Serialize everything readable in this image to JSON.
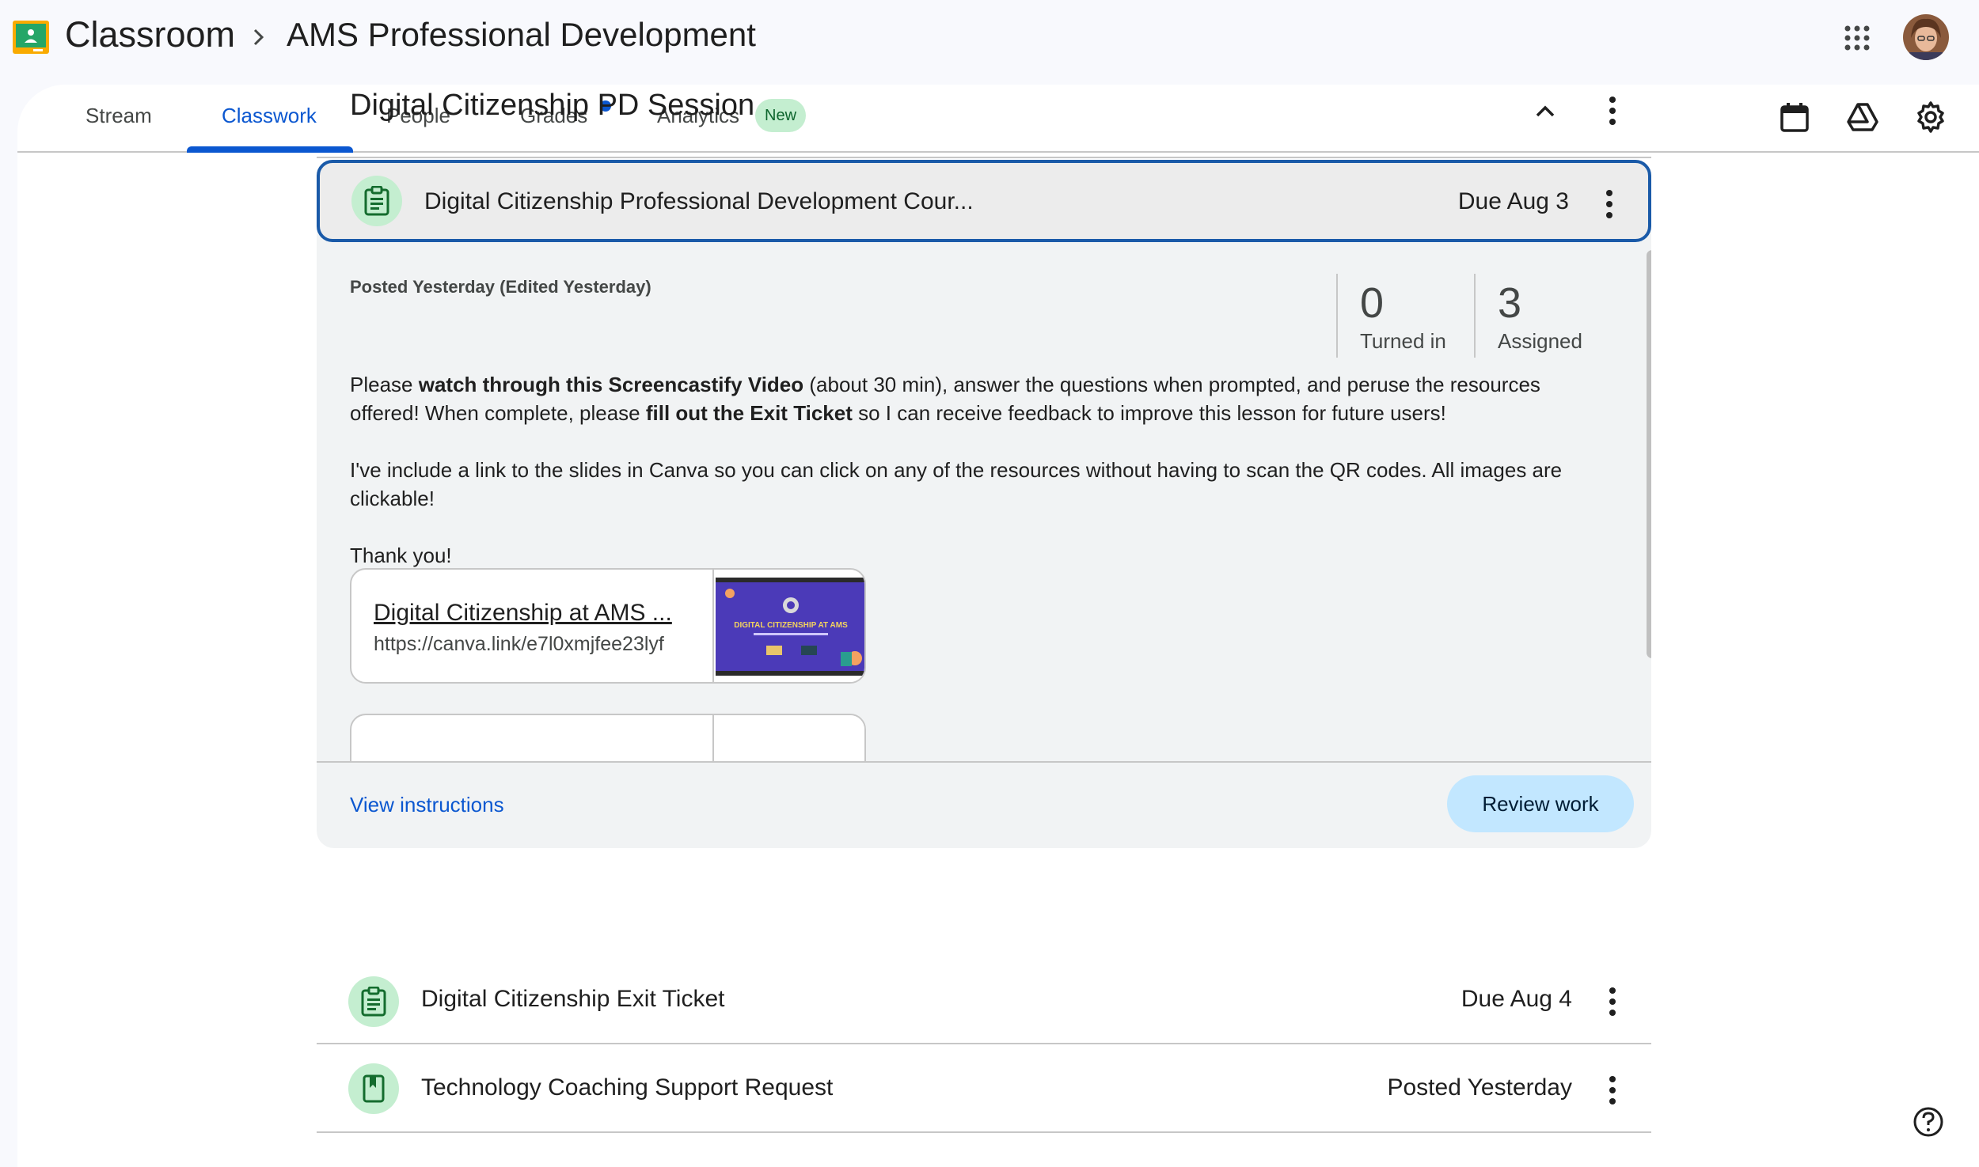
{
  "header": {
    "brand": "Classroom",
    "course": "AMS Professional Development"
  },
  "tabs": [
    {
      "label": "Stream"
    },
    {
      "label": "Classwork"
    },
    {
      "label": "People"
    },
    {
      "label": "Grades"
    },
    {
      "label": "Analytics"
    }
  ],
  "new_badge": "New",
  "topic": {
    "title": "Digital Citizenship PD Session"
  },
  "assignment": {
    "title": "Digital Citizenship Professional Development Cour...",
    "due": "Due Aug 3",
    "posted": "Posted Yesterday (Edited Yesterday)",
    "turned_in_count": "0",
    "turned_in_label": "Turned in",
    "assigned_count": "3",
    "assigned_label": "Assigned",
    "desc1_a": "Please ",
    "desc1_b": "watch through this Screencastify Video",
    "desc1_c": " (about 30 min), answer the questions when prompted, and peruse the resources offered! When complete, please ",
    "desc1_d": "fill out the Exit Ticket",
    "desc1_e": " so I can receive feedback to improve this lesson for future users!",
    "desc2": "I've include a link to the slides in Canva so you can click on any of the resources without having to scan the QR codes. All images are clickable!",
    "desc3": "Thank you!",
    "attachment": {
      "title": "Digital Citizenship at AMS ...",
      "url": "https://canva.link/e7l0xmjfee23lyf",
      "thumb_text": "DIGITAL CITIZENSHIP AT AMS"
    },
    "view_instructions": "View instructions",
    "review_work": "Review work"
  },
  "rows": [
    {
      "title": "Digital Citizenship Exit Ticket",
      "meta": "Due Aug 4"
    },
    {
      "title": "Technology Coaching Support Request",
      "meta": "Posted Yesterday"
    }
  ],
  "colors": {
    "accent": "#0b57d0",
    "icon_bg": "#c4eed0",
    "icon_fg": "#146c2e"
  }
}
